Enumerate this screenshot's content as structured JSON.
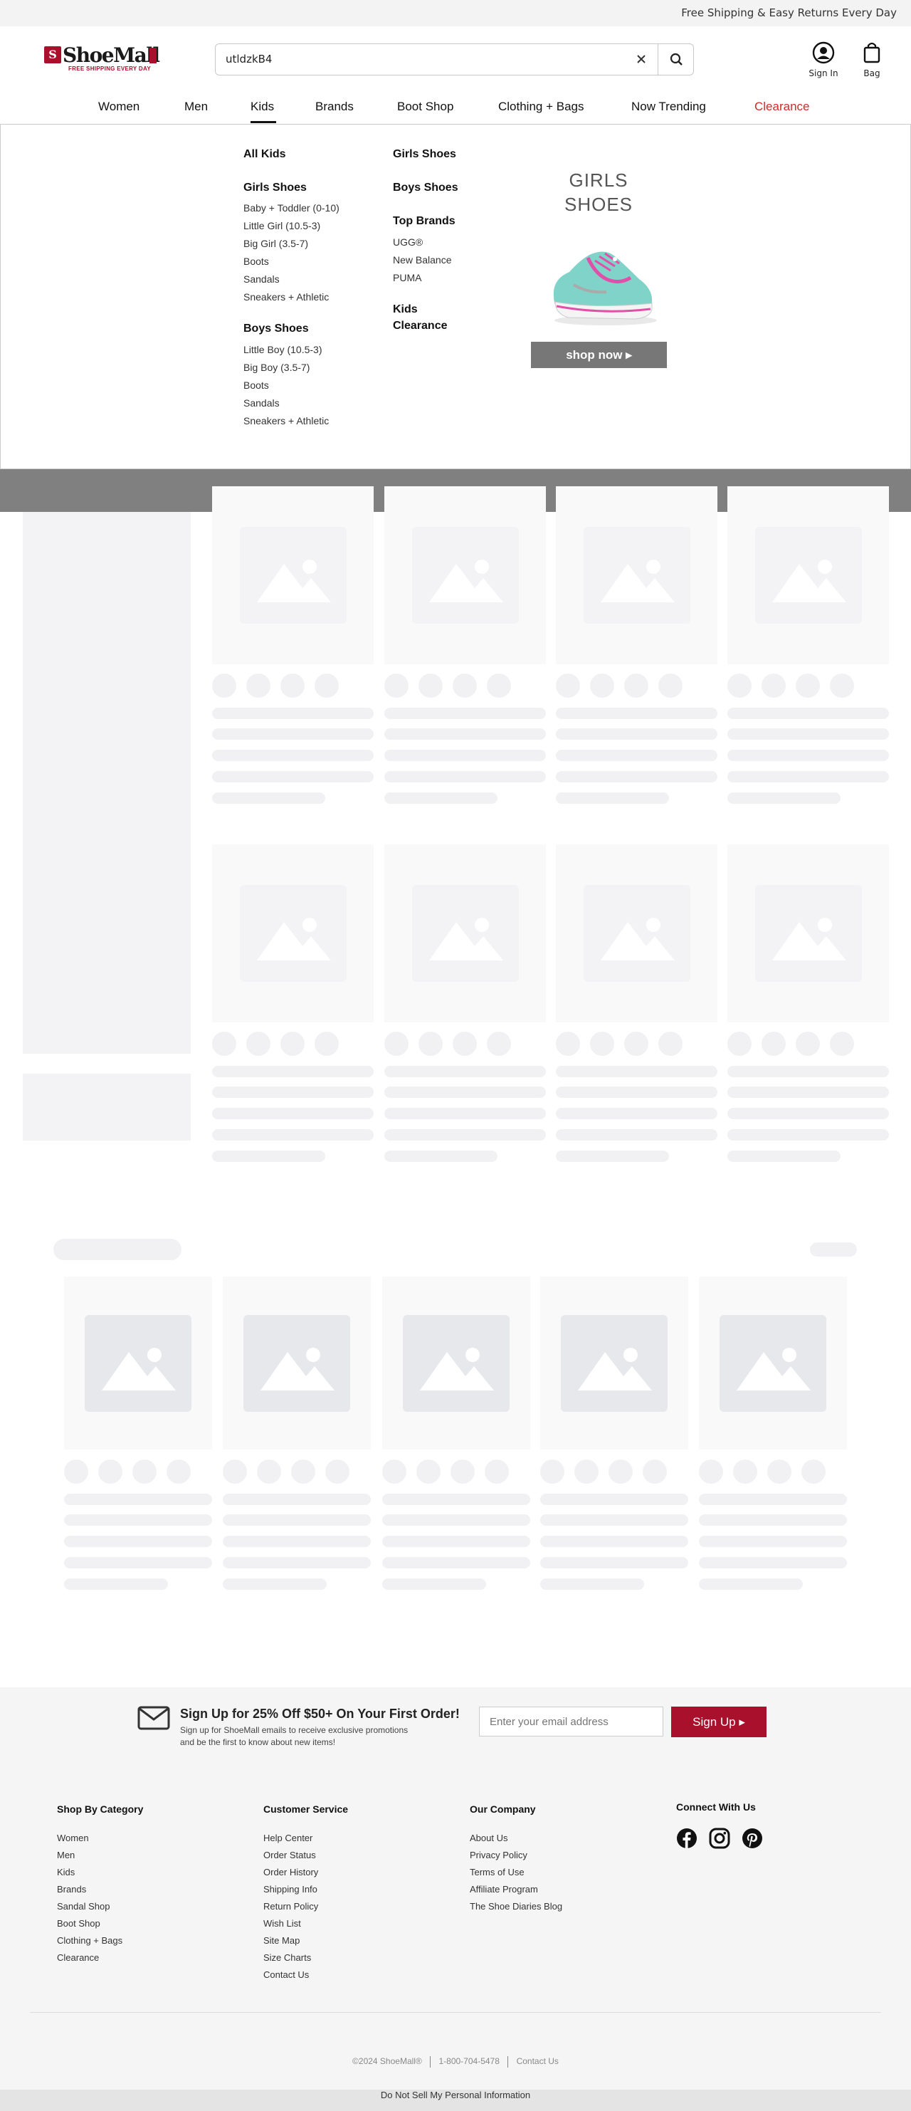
{
  "topbar": {
    "text": "Free Shipping & Easy Returns Every Day"
  },
  "logo": {
    "name": "ShoeMall",
    "tagline": "FREE SHIPPING EVERY DAY",
    "icon": "shoemall-logo"
  },
  "search": {
    "value": "utldzkB4",
    "clear_icon": "close-icon",
    "button_icon": "search-icon"
  },
  "account": {
    "label": "Sign In",
    "icon": "user-circle-icon"
  },
  "bag": {
    "label": "Bag",
    "icon": "bag-icon"
  },
  "nav": {
    "items": [
      {
        "label": "Women"
      },
      {
        "label": "Men"
      },
      {
        "label": "Kids"
      },
      {
        "label": "Brands"
      },
      {
        "label": "Boot Shop"
      },
      {
        "label": "Clothing + Bags"
      },
      {
        "label": "Now Trending"
      },
      {
        "label": "Clearance"
      }
    ],
    "active": "Kids",
    "clearance_color": "#d12a2a"
  },
  "kids_menu": {
    "col1": {
      "all": "All Kids",
      "girls_heading": "Girls Shoes",
      "girls_items": [
        "Baby + Toddler (0-10)",
        "Little Girl (10.5-3)",
        "Big Girl (3.5-7)",
        "Boots",
        "Sandals",
        "Sneakers + Athletic"
      ],
      "boys_heading": "Boys Shoes",
      "boys_items": [
        "Little Boy (10.5-3)",
        "Big Boy (3.5-7)",
        "Boots",
        "Sandals",
        "Sneakers + Athletic"
      ]
    },
    "col2": {
      "girls": "Girls Shoes",
      "boys": "Boys Shoes",
      "brands_heading": "Top Brands",
      "brands": [
        "UGG®",
        "New Balance",
        "PUMA"
      ],
      "clearance_line1": "Kids",
      "clearance_line2": "Clearance"
    },
    "promo": {
      "line1": "GIRLS",
      "line2": "SHOES",
      "button": "shop now ▸"
    }
  },
  "newsletter": {
    "icon": "envelope-icon",
    "headline": "Sign Up for 25% Off $50+ On Your First Order!",
    "sub1": "Sign up for ShoeMall emails to receive exclusive promotions",
    "sub2": "and be the first to know about new items!",
    "placeholder": "Enter your email address",
    "button": "Sign Up ▸",
    "button_color": "#a8102c"
  },
  "footer": {
    "category": {
      "heading": "Shop By Category",
      "items": [
        "Women",
        "Men",
        "Kids",
        "Brands",
        "Sandal Shop",
        "Boot Shop",
        "Clothing + Bags",
        "Clearance"
      ]
    },
    "service": {
      "heading": "Customer Service",
      "items": [
        "Help Center",
        "Order Status",
        "Order History",
        "Shipping Info",
        "Return Policy",
        "Wish List",
        "Site Map",
        "Size Charts",
        "Contact Us"
      ]
    },
    "company": {
      "heading": "Our Company",
      "items": [
        "About Us",
        "Privacy Policy",
        "Terms of Use",
        "Affiliate Program",
        "The Shoe Diaries Blog"
      ]
    },
    "connect": {
      "heading": "Connect With Us",
      "icons": [
        "facebook-icon",
        "instagram-icon",
        "pinterest-icon"
      ]
    },
    "copyright": "©2024 ShoeMall®",
    "phone": "1-800-704-5478",
    "contact": "Contact Us",
    "ccpa": "Do Not Sell My Personal Information"
  }
}
